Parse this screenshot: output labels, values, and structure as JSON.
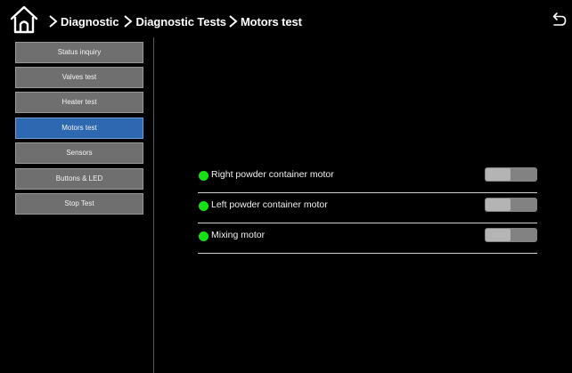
{
  "header": {
    "breadcrumbs": [
      "Diagnostic",
      "Diagnostic Tests",
      "Motors test"
    ]
  },
  "sidebar": {
    "items": [
      {
        "label": "Status inquiry",
        "active": false
      },
      {
        "label": "Valves test",
        "active": false
      },
      {
        "label": "Heater test",
        "active": false
      },
      {
        "label": "Motors test",
        "active": true
      },
      {
        "label": "Sensors",
        "active": false
      },
      {
        "label": "Buttons & LED",
        "active": false
      },
      {
        "label": "Stop Test",
        "active": false
      }
    ]
  },
  "main": {
    "motors": [
      {
        "label": "Right powder container motor",
        "status_color": "#16e016",
        "on": false
      },
      {
        "label": "Left powder container motor",
        "status_color": "#16e016",
        "on": false
      },
      {
        "label": "Mixing motor",
        "status_color": "#16e016",
        "on": false
      }
    ]
  },
  "colors": {
    "accent": "#2e68b1",
    "button": "#6f6f6f",
    "status_ok": "#16e016"
  }
}
